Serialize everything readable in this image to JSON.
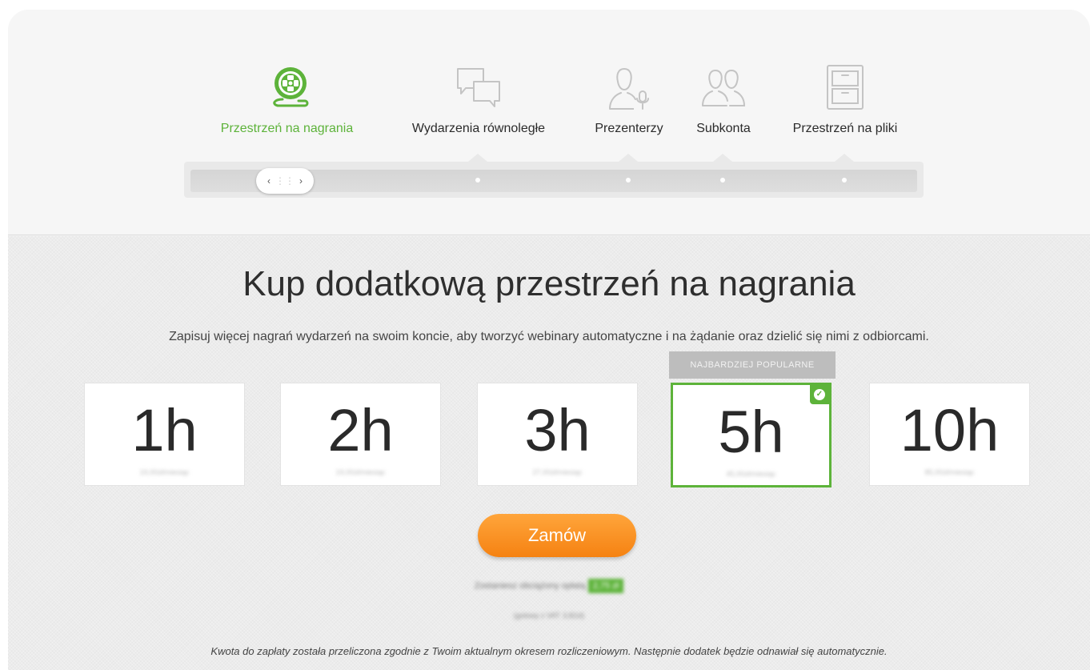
{
  "tabs": [
    {
      "label": "Przestrzeń na nagrania",
      "icon": "film-reel-icon",
      "active": true
    },
    {
      "label": "Wydarzenia równoległe",
      "icon": "chat-bubbles-icon",
      "active": false
    },
    {
      "label": "Prezenterzy",
      "icon": "presenter-mic-icon",
      "active": false
    },
    {
      "label": "Subkonta",
      "icon": "users-icon",
      "active": false
    },
    {
      "label": "Przestrzeń na pliki",
      "icon": "file-cabinet-icon",
      "active": false
    }
  ],
  "slider": {
    "left_arrow": "‹",
    "grip": "⋮⋮",
    "right_arrow": "›"
  },
  "main": {
    "title": "Kup dodatkową przestrzeń na nagrania",
    "subtitle": "Zapisuj więcej nagrań wydarzeń na swoim koncie, aby tworzyć webinary automatyczne i na żądanie oraz dzielić się nimi z odbiorcami."
  },
  "popular_badge": "NAJBARDZIEJ POPULARNE",
  "options": [
    {
      "hours": "1h",
      "price": "19,00zł/miesiąc"
    },
    {
      "hours": "2h",
      "price": "19,00zł/miesiąc"
    },
    {
      "hours": "3h",
      "price": "27,00zł/miesiąc"
    },
    {
      "hours": "5h",
      "price": "45,00zł/miesiąc",
      "selected": true
    },
    {
      "hours": "10h",
      "price": "85,00zł/miesiąc"
    }
  ],
  "order_button": "Zamów",
  "savings": {
    "text": "Zostaniesz obciążony opłatą",
    "amount": "2,75 zł"
  },
  "net_note": "(gotowy z VAT: 3,82zł)",
  "footer_note": "Kwota do zapłaty została przeliczona zgodnie z Twoim aktualnym okresem rozliczeniowym. Następnie dodatek będzie odnawiał się automatycznie.",
  "colors": {
    "accent_green": "#5db33a",
    "order_orange": "#f58212"
  }
}
